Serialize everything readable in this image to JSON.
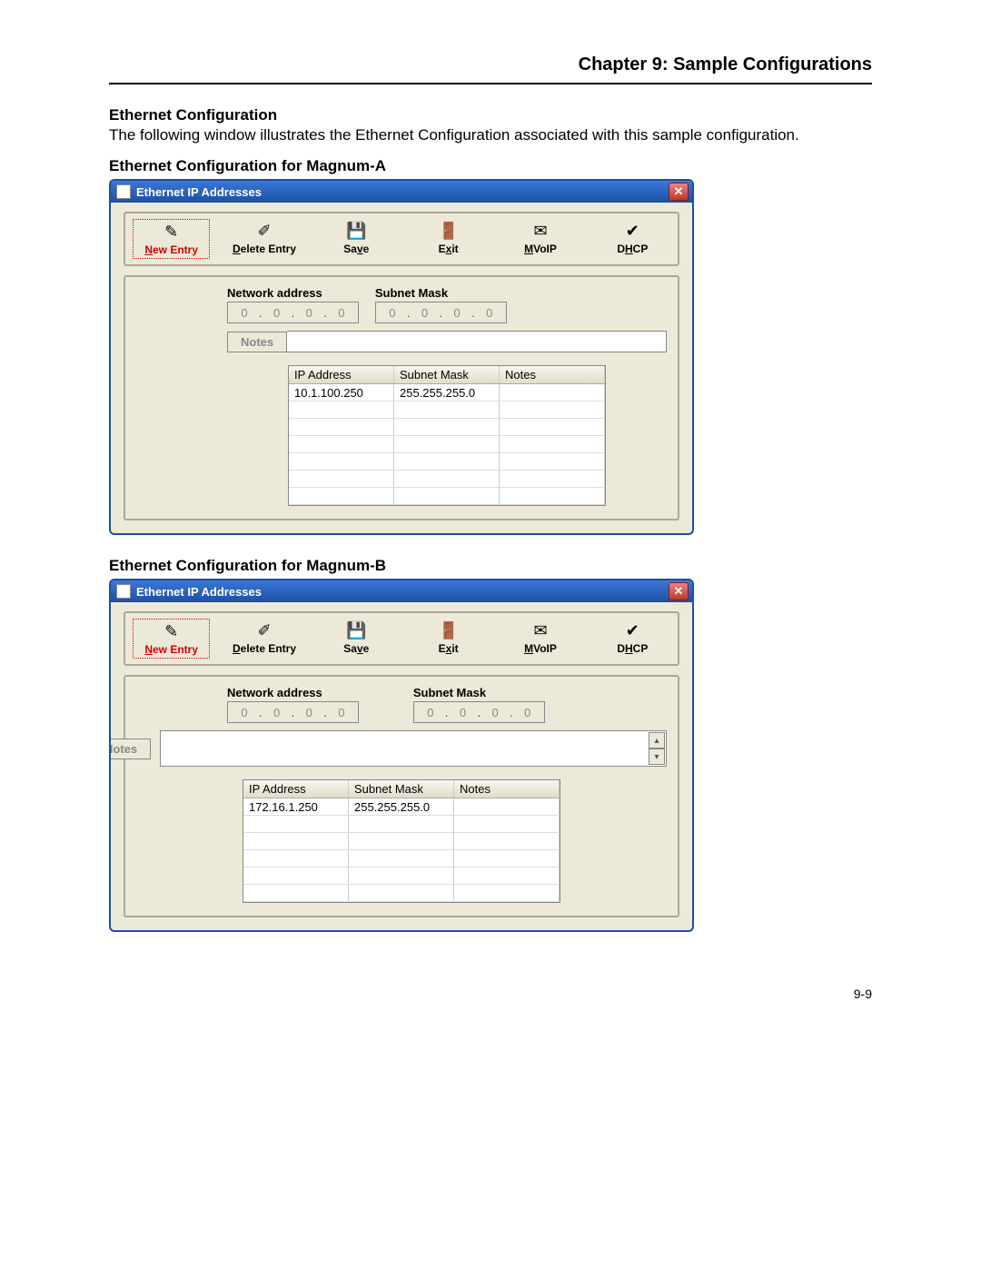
{
  "chapter_title": "Chapter 9: Sample Configurations",
  "section_heading": "Ethernet Configuration",
  "intro_text": "The following window illustrates the Ethernet Configuration associated with this sample configuration.",
  "page_number": "9-9",
  "subheading_a": "Ethernet Configuration for Magnum-A",
  "subheading_b": "Ethernet Configuration for Magnum-B",
  "window": {
    "title": "Ethernet IP Addresses",
    "toolbar": {
      "new_entry": "New Entry",
      "delete_entry": "Delete Entry",
      "save": "Save",
      "exit": "Exit",
      "mvoip": "MVoIP",
      "dhcp": "DHCP"
    },
    "labels": {
      "network_address": "Network address",
      "subnet_mask": "Subnet Mask",
      "notes": "Notes"
    },
    "ip_input": {
      "oct1": "0",
      "oct2": "0",
      "oct3": "0",
      "oct4": "0"
    },
    "mask_input": {
      "oct1": "0",
      "oct2": "0",
      "oct3": "0",
      "oct4": "0"
    },
    "grid": {
      "headers": {
        "ip": "IP Address",
        "mask": "Subnet Mask",
        "notes": "Notes"
      }
    }
  },
  "magnum_a": {
    "rows": [
      {
        "ip": "10.1.100.250",
        "mask": "255.255.255.0",
        "notes": ""
      }
    ]
  },
  "magnum_b": {
    "rows": [
      {
        "ip": "172.16.1.250",
        "mask": "255.255.255.0",
        "notes": ""
      }
    ]
  }
}
